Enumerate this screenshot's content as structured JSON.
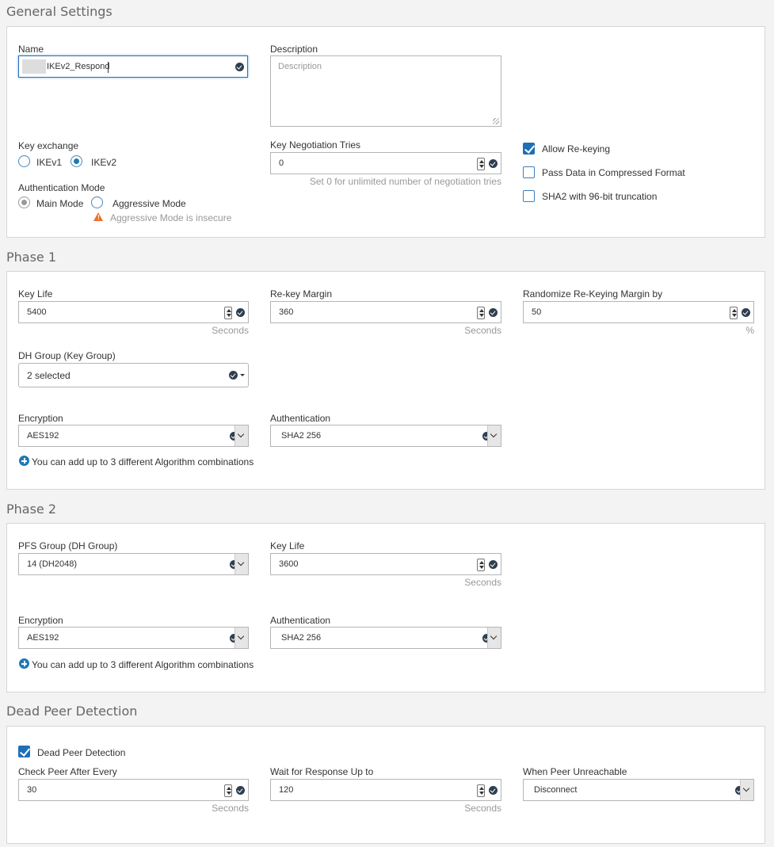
{
  "general": {
    "title": "General Settings",
    "name_label": "Name",
    "name_value": "IKEv2_Respond",
    "description_label": "Description",
    "description_placeholder": "Description",
    "key_exchange_label": "Key exchange",
    "ikev1_label": "IKEv1",
    "ikev2_label": "IKEv2",
    "auth_mode_label": "Authentication Mode",
    "main_mode_label": "Main Mode",
    "aggressive_mode_label": "Aggressive Mode",
    "aggressive_warning": "Aggressive Mode is insecure",
    "key_neg_label": "Key Negotiation Tries",
    "key_neg_value": "0",
    "key_neg_hint": "Set 0 for unlimited number of negotiation tries",
    "allow_rekeying_label": "Allow Re-keying",
    "pass_data_label": "Pass Data in Compressed Format",
    "sha2_label": "SHA2 with 96-bit truncation"
  },
  "phase1": {
    "title": "Phase 1",
    "key_life_label": "Key Life",
    "key_life_value": "5400",
    "key_life_unit": "Seconds",
    "rekey_margin_label": "Re-key Margin",
    "rekey_margin_value": "360",
    "rekey_margin_unit": "Seconds",
    "randomize_label": "Randomize Re-Keying Margin by",
    "randomize_value": "50",
    "randomize_unit": "%",
    "dh_group_label": "DH Group (Key Group)",
    "dh_group_value": "2 selected",
    "encryption_label": "Encryption",
    "encryption_value": "AES192",
    "authentication_label": "Authentication",
    "authentication_value": "SHA2 256",
    "add_combo": "You can add up to 3 different Algorithm combinations"
  },
  "phase2": {
    "title": "Phase 2",
    "pfs_label": "PFS Group (DH Group)",
    "pfs_value": "14 (DH2048)",
    "key_life_label": "Key Life",
    "key_life_value": "3600",
    "key_life_unit": "Seconds",
    "encryption_label": "Encryption",
    "encryption_value": "AES192",
    "authentication_label": "Authentication",
    "authentication_value": "SHA2 256",
    "add_combo": "You can add up to 3 different Algorithm combinations"
  },
  "dpd": {
    "title": "Dead Peer Detection",
    "enable_label": "Dead Peer Detection",
    "check_label": "Check Peer After Every",
    "check_value": "30",
    "check_unit": "Seconds",
    "wait_label": "Wait for Response Up to",
    "wait_value": "120",
    "wait_unit": "Seconds",
    "unreachable_label": "When Peer Unreachable",
    "unreachable_value": "Disconnect"
  },
  "state": {
    "key_exchange": "IKEv2",
    "auth_mode": "Main Mode",
    "allow_rekeying": true,
    "pass_data": false,
    "sha2_96": false,
    "dpd_enabled": true
  },
  "colors": {
    "accent": "#1f78b4",
    "warning": "#e8702a",
    "check_dark": "#2d3e50"
  }
}
